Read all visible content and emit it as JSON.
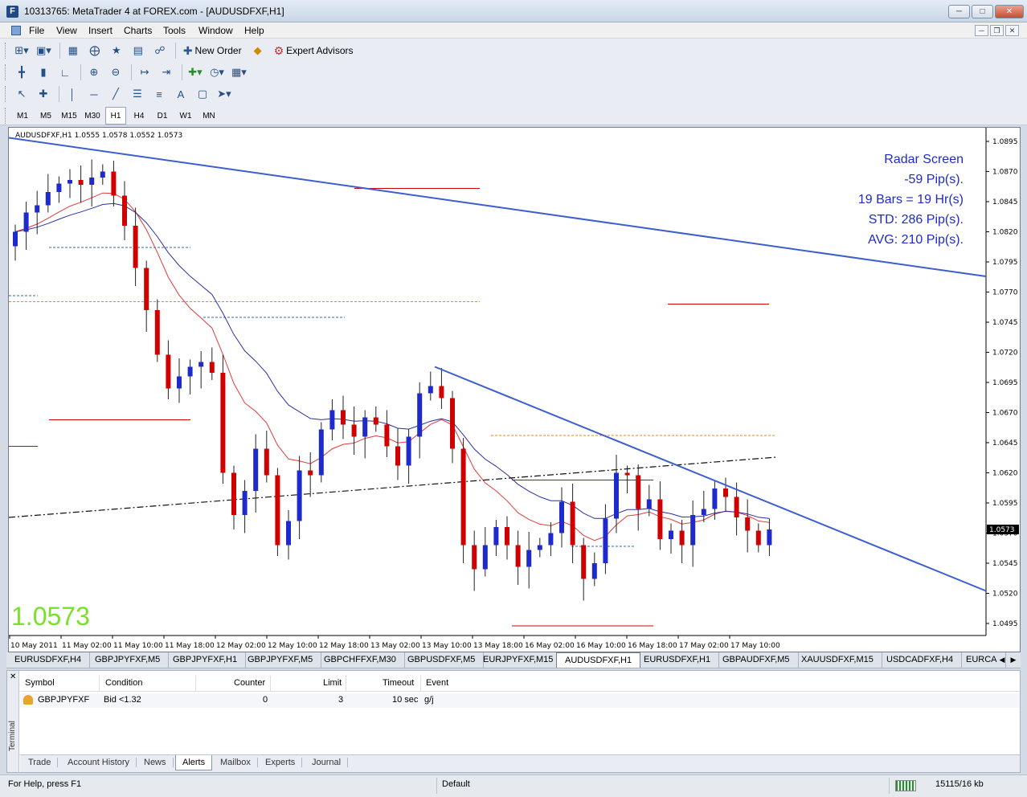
{
  "window": {
    "title": "10313765: MetaTrader 4 at FOREX.com - [AUDUSDFXF,H1]",
    "icon": "F",
    "controls": [
      "minimize",
      "maximize",
      "close"
    ]
  },
  "menu": [
    "File",
    "View",
    "Insert",
    "Charts",
    "Tools",
    "Window",
    "Help"
  ],
  "toolbar": {
    "new_order": "New Order",
    "expert_advisors": "Expert Advisors"
  },
  "timeframes": [
    "M1",
    "M5",
    "M15",
    "M30",
    "H1",
    "H4",
    "D1",
    "W1",
    "MN"
  ],
  "active_timeframe": "H1",
  "chart": {
    "header": "AUDUSDFXF,H1  1.0555 1.0578 1.0552 1.0573",
    "current_price": "1.0573",
    "info_lines": [
      "Radar Screen",
      "-59 Pip(s).",
      "19 Bars = 19 Hr(s)",
      "STD: 286 Pip(s).",
      "AVG: 210 Pip(s)."
    ],
    "colors": {
      "bull": "#1f2acc",
      "bear": "#d00000",
      "trend": "#3b5fce",
      "ma_fast": "#e23a3a",
      "ma_slow": "#2a2fa0",
      "big_price": "#7be02a"
    }
  },
  "chart_data": {
    "type": "candlestick",
    "symbol": "AUDUSDFXF",
    "timeframe": "H1",
    "price_axis": [
      "1.0895",
      "1.0870",
      "1.0845",
      "1.0820",
      "1.0795",
      "1.0770",
      "1.0745",
      "1.0720",
      "1.0695",
      "1.0670",
      "1.0645",
      "1.0620",
      "1.0595",
      "1.0570",
      "1.0545",
      "1.0520",
      "1.0495"
    ],
    "ylim": [
      1.0485,
      1.0905
    ],
    "time_axis": [
      "10 May 2011",
      "11 May 02:00",
      "11 May 10:00",
      "11 May 18:00",
      "12 May 02:00",
      "12 May 10:00",
      "12 May 18:00",
      "13 May 02:00",
      "13 May 10:00",
      "13 May 18:00",
      "16 May 02:00",
      "16 May 10:00",
      "16 May 18:00",
      "17 May 02:00",
      "17 May 10:00"
    ],
    "current_price": 1.0573,
    "closes": [
      1.082,
      1.0836,
      1.0842,
      1.0853,
      1.086,
      1.0863,
      1.0859,
      1.0865,
      1.087,
      1.085,
      1.0825,
      1.079,
      1.0755,
      1.0718,
      1.069,
      1.07,
      1.0708,
      1.0712,
      1.0703,
      1.062,
      1.0585,
      1.0605,
      1.064,
      1.0618,
      1.056,
      1.058,
      1.0622,
      1.0618,
      1.0656,
      1.0672,
      1.066,
      1.065,
      1.0666,
      1.066,
      1.0642,
      1.0626,
      1.065,
      1.0686,
      1.0692,
      1.0682,
      1.064,
      1.056,
      1.054,
      1.056,
      1.0575,
      1.056,
      1.0542,
      1.0556,
      1.056,
      1.057,
      1.0596,
      1.056,
      1.0532,
      1.0545,
      1.0582,
      1.062,
      1.0618,
      1.059,
      1.0598,
      1.0565,
      1.0572,
      1.056,
      1.0585,
      1.059,
      1.0607,
      1.06,
      1.0583,
      1.0572,
      1.056,
      1.0573
    ],
    "trendlines": [
      {
        "name": "upper-trendline",
        "from": [
          "10 May 2011",
          1.0898
        ],
        "to": [
          "17 May 10:00+",
          1.0783
        ]
      },
      {
        "name": "lower-trendline",
        "from": [
          "13 May 10:00",
          1.0708
        ],
        "to": [
          "17 May 10:00+",
          1.0522
        ]
      }
    ],
    "grid": false
  },
  "chart_tabs": [
    "EURUSDFXF,H4",
    "GBPJPYFXF,M5",
    "GBPJPYFXF,H1",
    "GBPJPYFXF,M5",
    "GBPCHFFXF,M30",
    "GBPUSDFXF,M5",
    "EURJPYFXF,M15",
    "AUDUSDFXF,H1",
    "EURUSDFXF,H1",
    "GBPAUDFXF,M5",
    "XAUUSDFXF,M15",
    "USDCADFXF,H4",
    "EURCA"
  ],
  "active_chart_tab": "AUDUSDFXF,H1",
  "terminal": {
    "side_label": "Terminal",
    "columns": [
      "Symbol",
      "Condition",
      "Counter",
      "Limit",
      "Timeout",
      "Event"
    ],
    "rows": [
      {
        "symbol": "GBPJPYFXF",
        "condition": "Bid <1.32",
        "counter": "0",
        "limit": "3",
        "timeout": "10 sec",
        "event": "g/j"
      }
    ],
    "tabs": [
      "Trade",
      "Account History",
      "News",
      "Alerts",
      "Mailbox",
      "Experts",
      "Journal"
    ],
    "active_tab": "Alerts"
  },
  "status": {
    "help": "For Help, press F1",
    "profile": "Default",
    "traffic": "15115/16 kb"
  }
}
